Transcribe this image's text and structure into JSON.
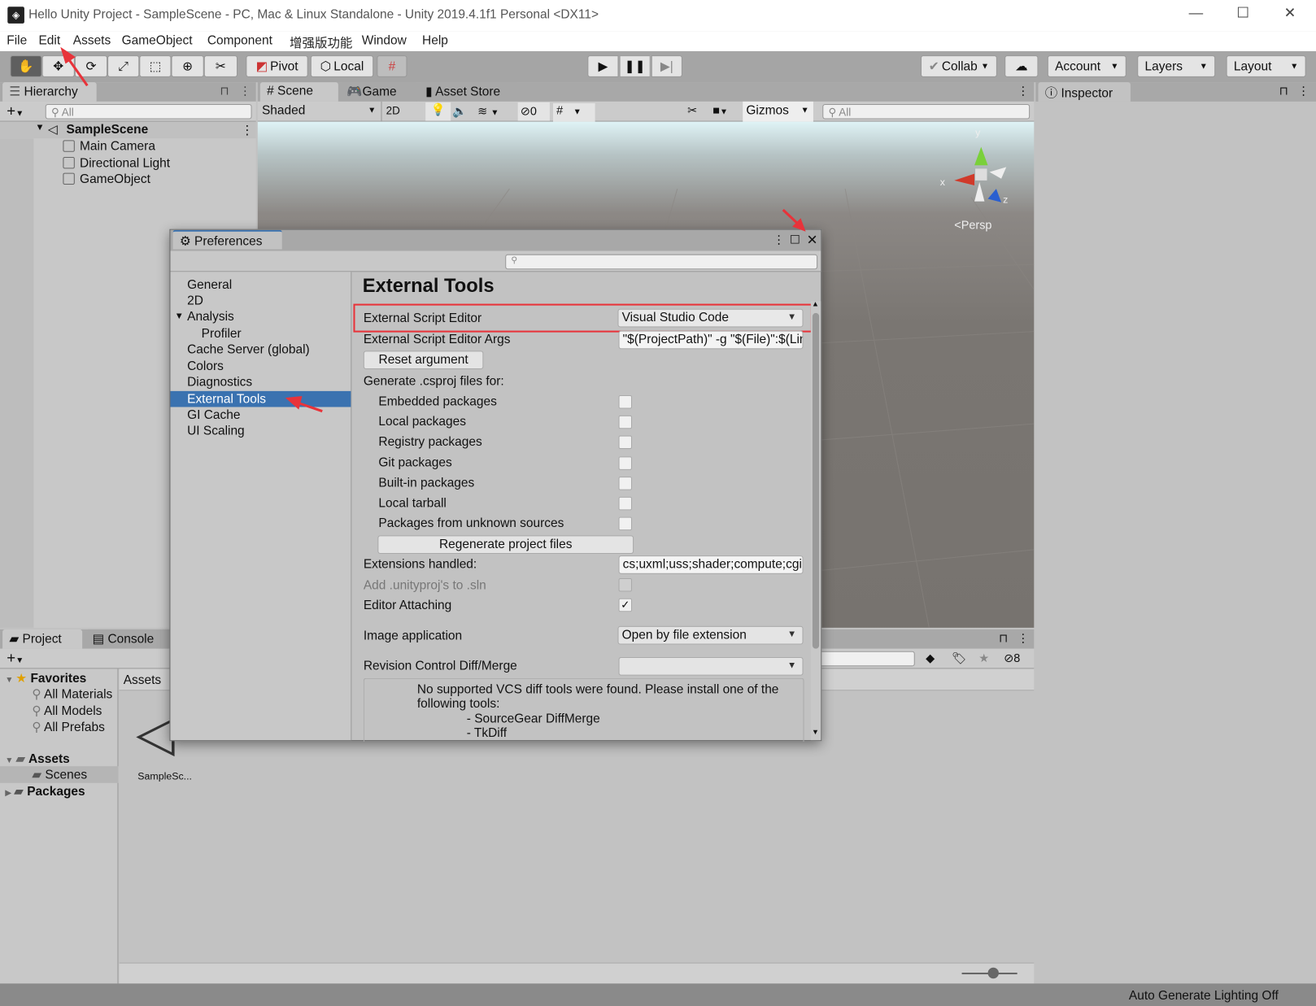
{
  "window": {
    "title": "Hello Unity Project - SampleScene - PC, Mac & Linux Standalone - Unity 2019.4.1f1 Personal <DX11>"
  },
  "menu": [
    "File",
    "Edit",
    "Assets",
    "GameObject",
    "Component",
    "增强版功能",
    "Window",
    "Help"
  ],
  "toolbar": {
    "pivot": "Pivot",
    "local": "Local",
    "collab": "Collab",
    "account": "Account",
    "layers": "Layers",
    "layout": "Layout"
  },
  "hierarchy": {
    "tab": "Hierarchy",
    "search_placeholder": "All",
    "scene": "SampleScene",
    "items": [
      "Main Camera",
      "Directional Light",
      "GameObject"
    ]
  },
  "scene": {
    "tabs": [
      "Scene",
      "Game",
      "Asset Store"
    ],
    "shading": "Shaded",
    "mode_2d": "2D",
    "hidden_count": "0",
    "gizmos": "Gizmos",
    "search_placeholder": "All",
    "persp": "Persp",
    "axis_x": "x",
    "axis_y": "y",
    "axis_z": "z"
  },
  "inspector": {
    "tab": "Inspector"
  },
  "project": {
    "tabs": [
      "Project",
      "Console"
    ],
    "favorites": "Favorites",
    "fav_items": [
      "All Materials",
      "All Models",
      "All Prefabs"
    ],
    "assets": "Assets",
    "scenes": "Scenes",
    "packages": "Packages",
    "breadcrumb": "Assets",
    "asset_name": "SampleSc...",
    "hidden_count": "8"
  },
  "status": {
    "text": "Auto Generate Lighting Off"
  },
  "preferences": {
    "title": "Preferences",
    "sidebar": [
      "General",
      "2D",
      "Analysis",
      "Profiler",
      "Cache Server (global)",
      "Colors",
      "Diagnostics",
      "External Tools",
      "GI Cache",
      "UI Scaling"
    ],
    "selected": "External Tools",
    "heading": "External Tools",
    "ext_editor_label": "External Script Editor",
    "ext_editor_value": "Visual Studio Code",
    "args_label": "External Script Editor Args",
    "args_value": "\"$(ProjectPath)\" -g \"$(File)\":$(Line):$(Column)",
    "reset_button": "Reset argument",
    "generate_label": "Generate .csproj files for:",
    "packages": [
      {
        "label": "Embedded packages",
        "checked": false
      },
      {
        "label": "Local packages",
        "checked": false
      },
      {
        "label": "Registry packages",
        "checked": false
      },
      {
        "label": "Git packages",
        "checked": false
      },
      {
        "label": "Built-in packages",
        "checked": false
      },
      {
        "label": "Local tarball",
        "checked": false
      },
      {
        "label": "Packages from unknown sources",
        "checked": false
      }
    ],
    "regenerate_button": "Regenerate project files",
    "extensions_label": "Extensions handled:",
    "extensions_value": "cs;uxml;uss;shader;compute;cginc",
    "unityproj_label": "Add .unityproj's to .sln",
    "attaching_label": "Editor Attaching",
    "attaching_check": "✓",
    "image_app_label": "Image application",
    "image_app_value": "Open by file extension",
    "revision_label": "Revision Control Diff/Merge",
    "revision_value": "",
    "vcs_msg_1": "No supported VCS diff tools were found. Please install one of the",
    "vcs_msg_2": "following tools:",
    "vcs_tool_1": "- SourceGear DiffMerge",
    "vcs_tool_2": "- TkDiff"
  },
  "colors": {
    "accent": "#3a72b0",
    "highlight": "#e8333a"
  }
}
